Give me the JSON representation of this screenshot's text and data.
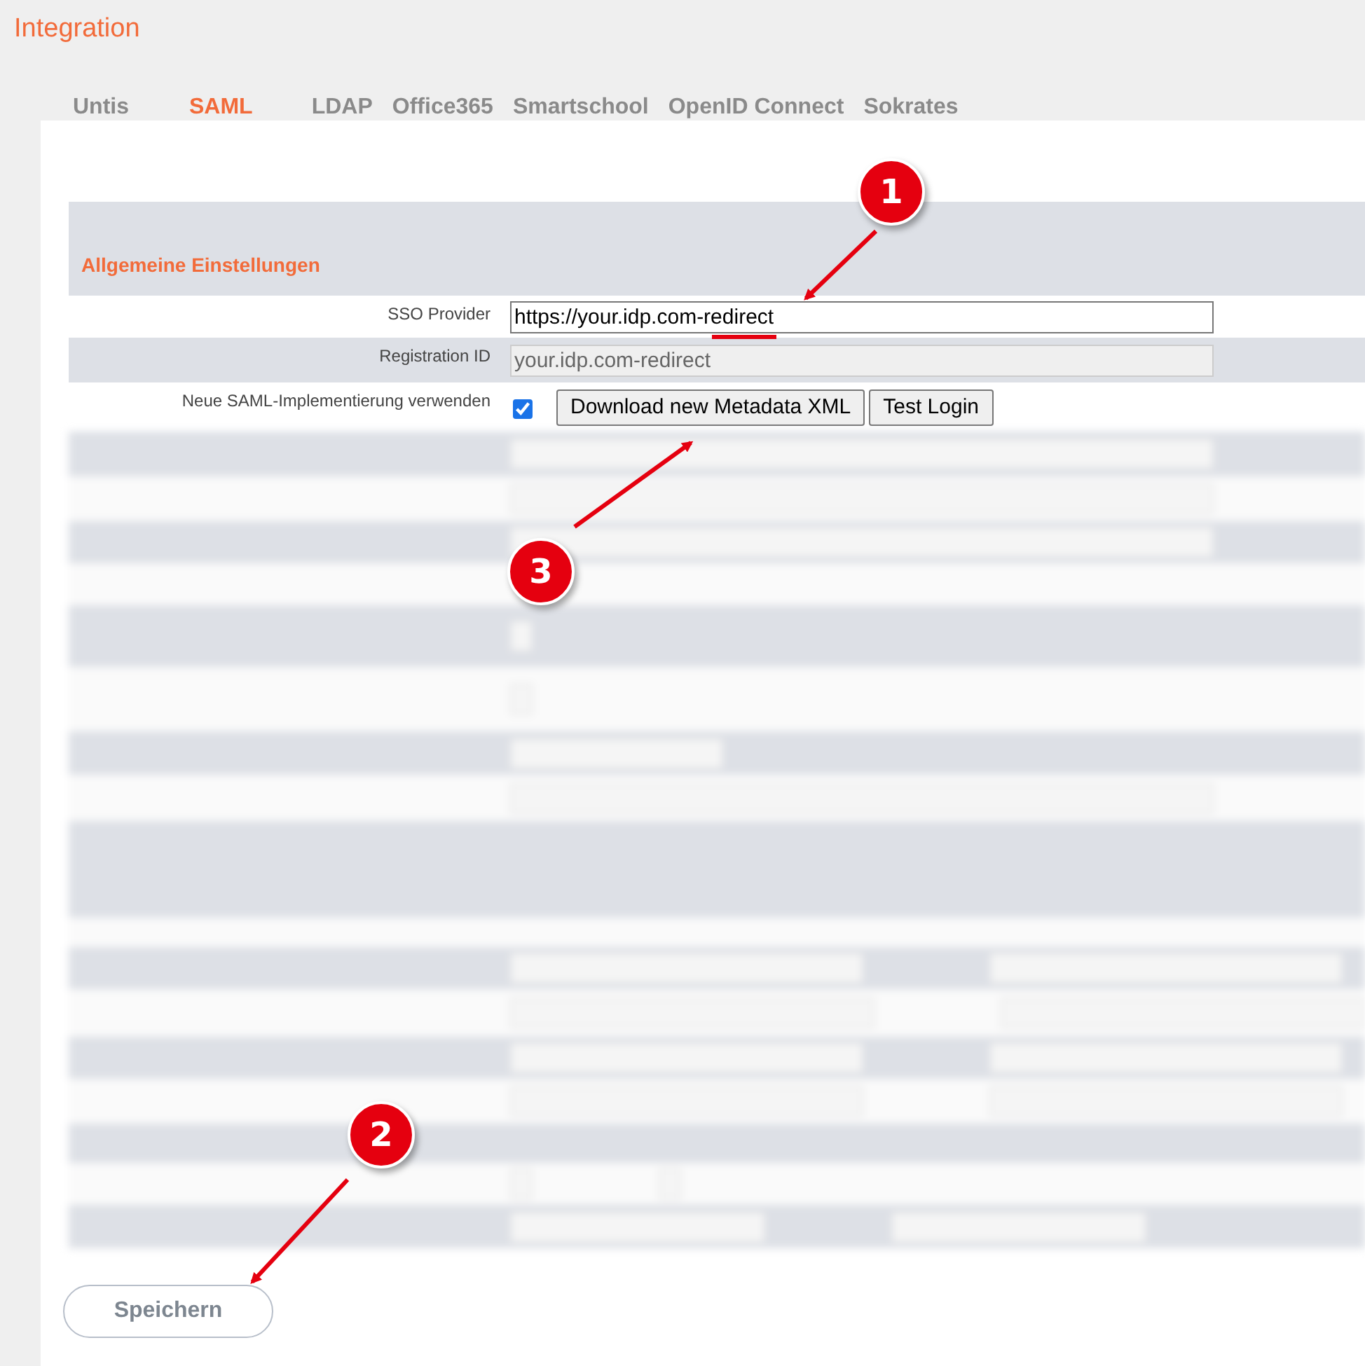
{
  "page_title": "Integration",
  "tabs": [
    {
      "label": "Untis",
      "selected": false
    },
    {
      "label": "SAML",
      "selected": true
    },
    {
      "label": "LDAP",
      "selected": false
    },
    {
      "label": "Office365",
      "selected": false
    },
    {
      "label": "Smartschool",
      "selected": false
    },
    {
      "label": "OpenID Connect",
      "selected": false
    },
    {
      "label": "Sokrates",
      "selected": false
    }
  ],
  "section_title": "Allgemeine Einstellungen",
  "fields": [
    {
      "kind": "input",
      "label": "SSO Provider",
      "value": "https://your.idp.com-redirect"
    },
    {
      "kind": "readonly",
      "label": "Registration ID",
      "value": "your.idp.com-redirect"
    },
    {
      "kind": "checkbox",
      "label": "Neue SAML-Implementierung verwenden",
      "checked": true,
      "buttons": [
        "Download new Metadata XML",
        "Test Login"
      ]
    }
  ],
  "save_button": "Speichern",
  "annotations": [
    {
      "number": "1"
    },
    {
      "number": "2"
    },
    {
      "number": "3"
    }
  ]
}
